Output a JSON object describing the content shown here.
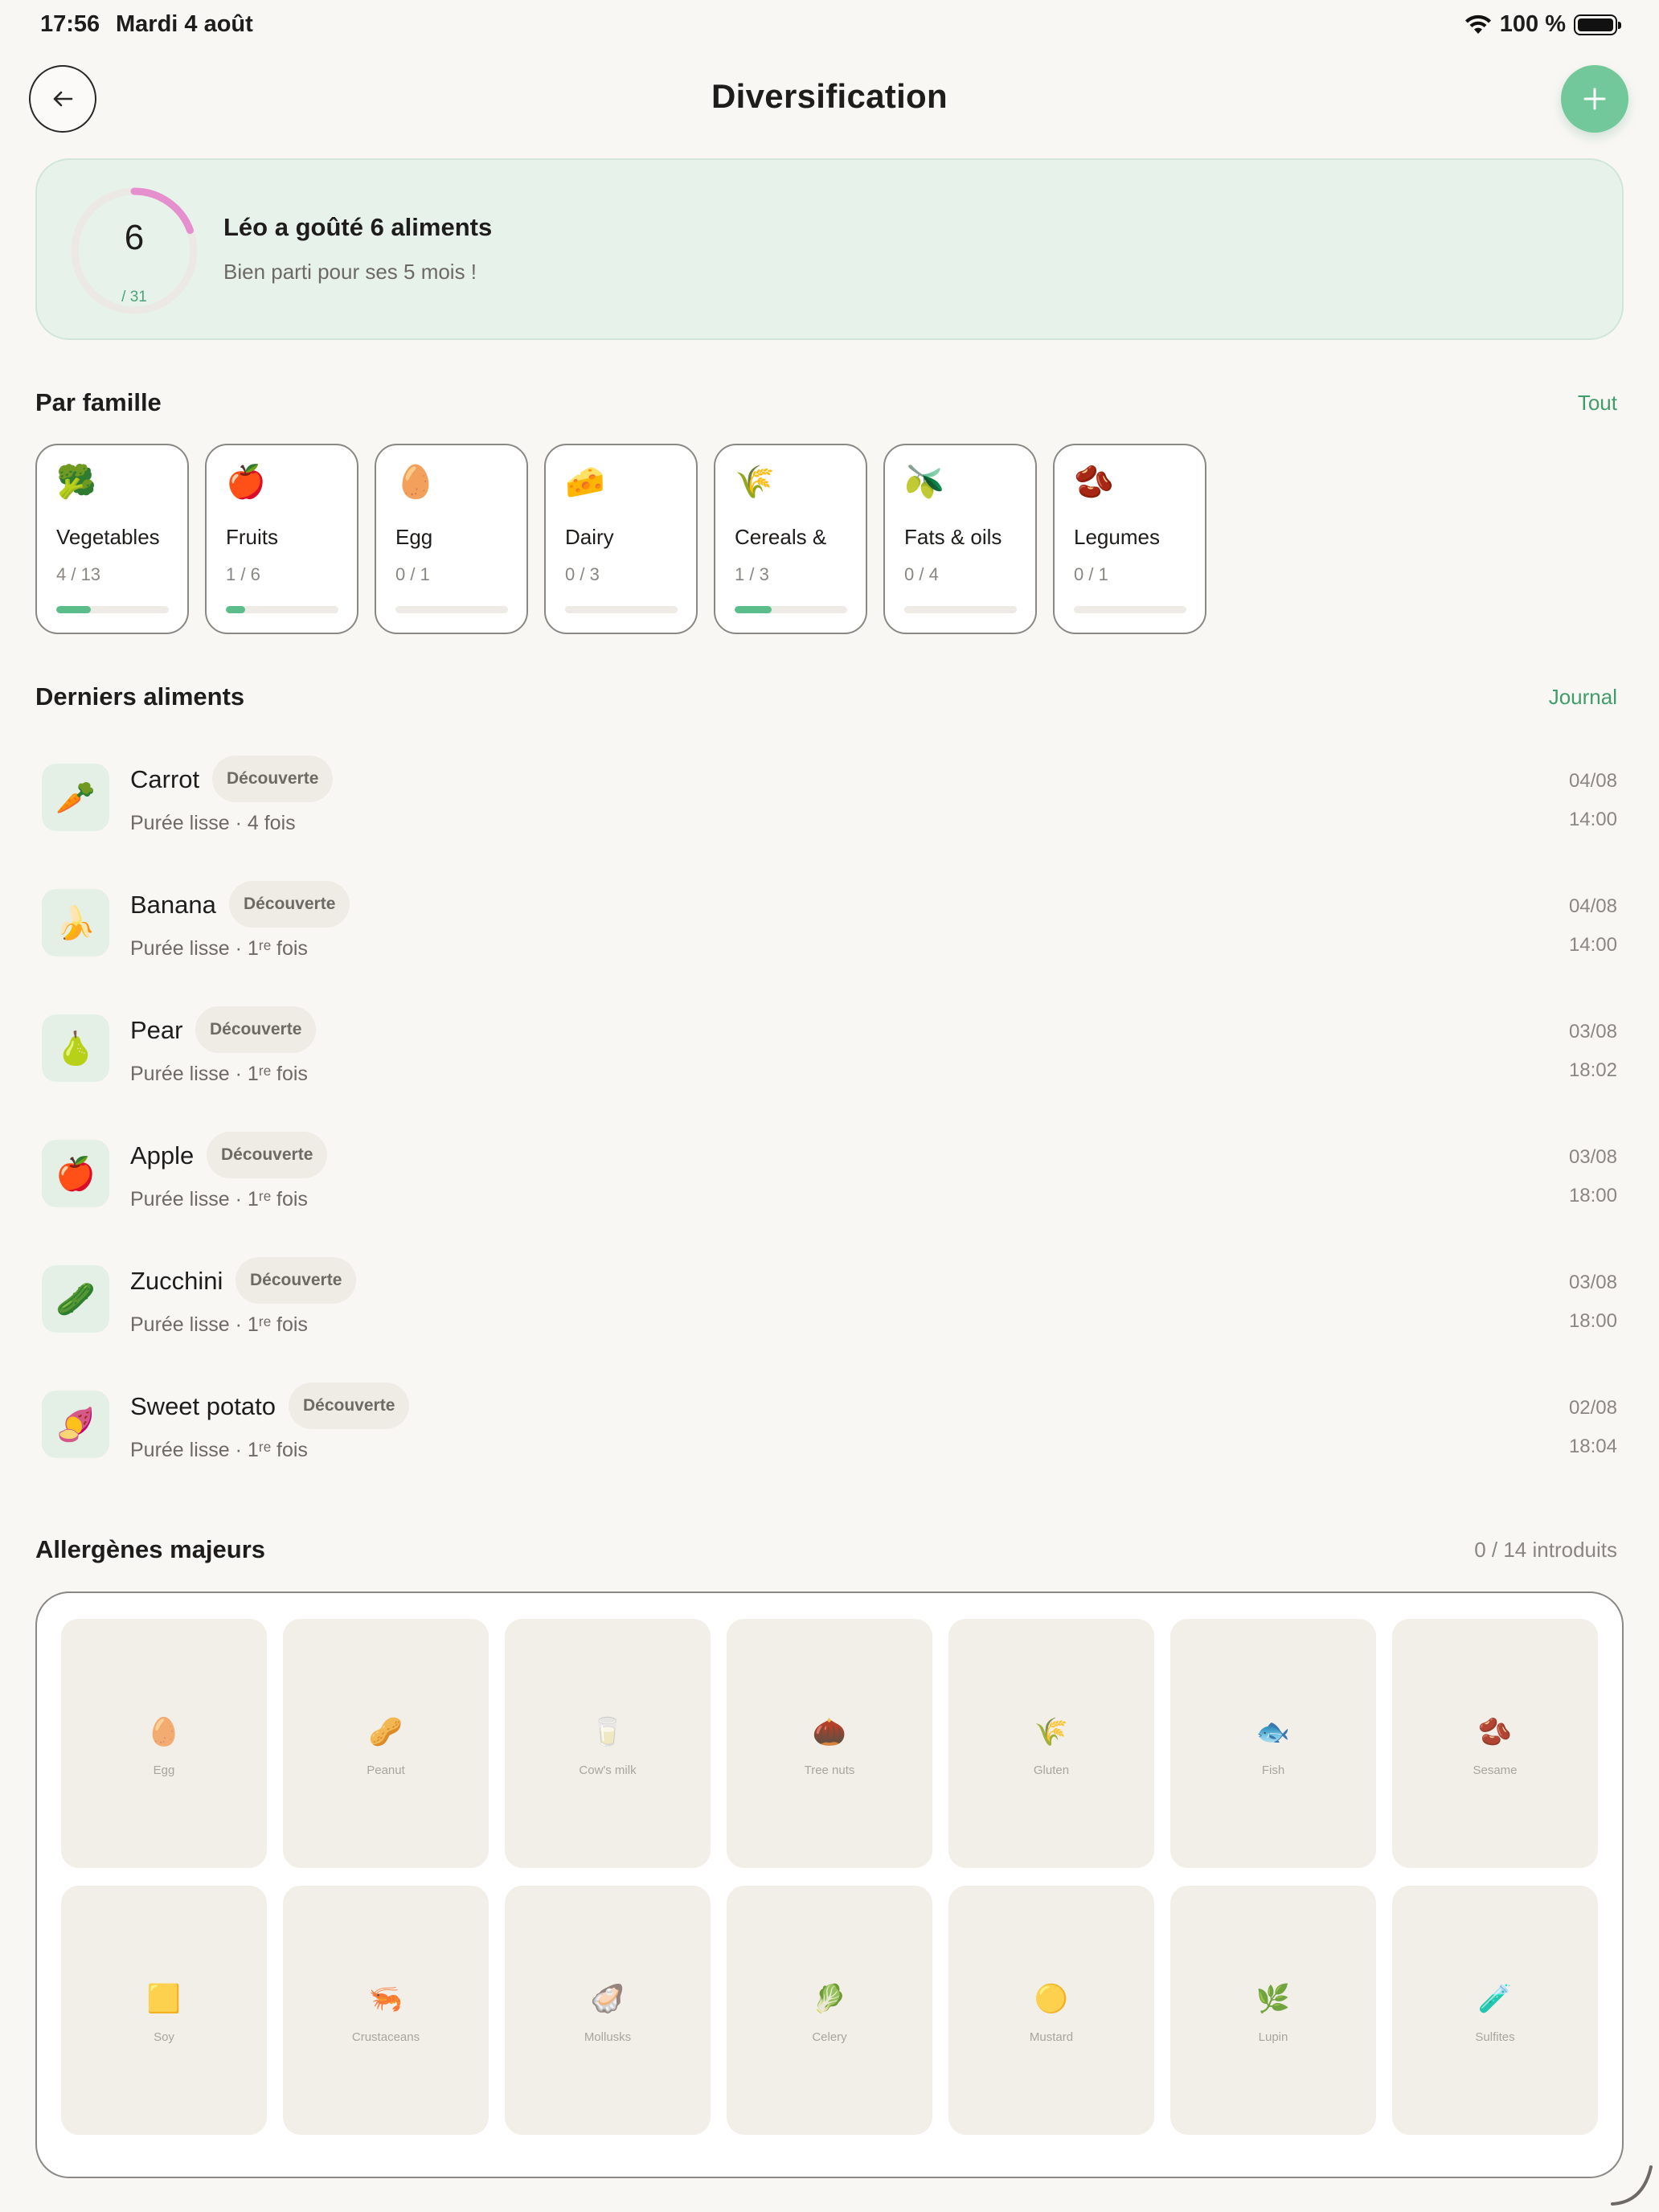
{
  "status_bar": {
    "time": "17:56",
    "date": "Mardi 4 août",
    "battery": "100 %"
  },
  "nav": {
    "title": "Diversification"
  },
  "summary": {
    "tasted": "6",
    "total": "/ 31",
    "headline": "Léo a goûté 6 aliments",
    "subtitle": "Bien parti pour ses 5 mois !",
    "progress_fraction": 0.194,
    "ring_color": "#e58fcf",
    "ring_track_color": "#ece8e3"
  },
  "families_section": {
    "title": "Par famille",
    "link": "Tout"
  },
  "families": [
    {
      "icon": "🥦",
      "icon_name": "broccoli-icon",
      "name": "Vegetables",
      "count": "4 / 13",
      "progress": 0.31
    },
    {
      "icon": "🍎",
      "icon_name": "apple-icon",
      "name": "Fruits",
      "count": "1 / 6",
      "progress": 0.17
    },
    {
      "icon": "🥚",
      "icon_name": "egg-icon",
      "name": "Egg",
      "count": "0 / 1",
      "progress": 0
    },
    {
      "icon": "🧀",
      "icon_name": "cheese-icon",
      "name": "Dairy",
      "count": "0 / 3",
      "progress": 0
    },
    {
      "icon": "🌾",
      "icon_name": "wheat-icon",
      "name": "Cereals &",
      "count": "1 / 3",
      "progress": 0.33
    },
    {
      "icon": "🫒",
      "icon_name": "olive-icon",
      "name": "Fats & oils",
      "count": "0 / 4",
      "progress": 0
    },
    {
      "icon": "🫘",
      "icon_name": "beans-icon",
      "name": "Legumes",
      "count": "0 / 1",
      "progress": 0
    }
  ],
  "recent_section": {
    "title": "Derniers aliments",
    "link": "Journal"
  },
  "recent": [
    {
      "icon": "🥕",
      "icon_name": "carrot-icon",
      "name": "Carrot",
      "badge": "Découverte",
      "texture": "Purée lisse · 4 fois",
      "date": "04/08",
      "time": "14:00"
    },
    {
      "icon": "🍌",
      "icon_name": "banana-icon",
      "name": "Banana",
      "badge": "Découverte",
      "texture": "Purée lisse · 1ʳᵉ fois",
      "date": "04/08",
      "time": "14:00"
    },
    {
      "icon": "🍐",
      "icon_name": "pear-icon",
      "name": "Pear",
      "badge": "Découverte",
      "texture": "Purée lisse · 1ʳᵉ fois",
      "date": "03/08",
      "time": "18:02"
    },
    {
      "icon": "🍎",
      "icon_name": "apple-icon",
      "name": "Apple",
      "badge": "Découverte",
      "texture": "Purée lisse · 1ʳᵉ fois",
      "date": "03/08",
      "time": "18:00"
    },
    {
      "icon": "🥒",
      "icon_name": "zucchini-icon",
      "name": "Zucchini",
      "badge": "Découverte",
      "texture": "Purée lisse · 1ʳᵉ fois",
      "date": "03/08",
      "time": "18:00"
    },
    {
      "icon": "🍠",
      "icon_name": "sweet-potato-icon",
      "name": "Sweet potato",
      "badge": "Découverte",
      "texture": "Purée lisse · 1ʳᵉ fois",
      "date": "02/08",
      "time": "18:04"
    }
  ],
  "allergens_section": {
    "title": "Allergènes majeurs",
    "meta": "0 / 14 introduits"
  },
  "allergens": [
    {
      "icon": "🥚",
      "icon_name": "egg-icon",
      "label": "Egg"
    },
    {
      "icon": "🥜",
      "icon_name": "peanut-icon",
      "label": "Peanut"
    },
    {
      "icon": "🥛",
      "icon_name": "milk-icon",
      "label": "Cow's milk"
    },
    {
      "icon": "🌰",
      "icon_name": "chestnut-icon",
      "label": "Tree nuts"
    },
    {
      "icon": "🌾",
      "icon_name": "wheat-icon",
      "label": "Gluten"
    },
    {
      "icon": "🐟",
      "icon_name": "fish-icon",
      "label": "Fish"
    },
    {
      "icon": "🫘",
      "icon_name": "beans-icon",
      "label": "Sesame"
    },
    {
      "icon": "🟨",
      "icon_name": "soy-square-icon",
      "label": "Soy"
    },
    {
      "icon": "🦐",
      "icon_name": "shrimp-icon",
      "label": "Crustaceans"
    },
    {
      "icon": "🦪",
      "icon_name": "oyster-icon",
      "label": "Mollusks"
    },
    {
      "icon": "🥬",
      "icon_name": "leafy-green-icon",
      "label": "Celery"
    },
    {
      "icon": "🟡",
      "icon_name": "mustard-circle-icon",
      "label": "Mustard"
    },
    {
      "icon": "🌿",
      "icon_name": "herb-icon",
      "label": "Lupin"
    },
    {
      "icon": "🧪",
      "icon_name": "test-tube-icon",
      "label": "Sulfites"
    }
  ],
  "colors": {
    "accent": "#3f9d6a",
    "add_button": "#73c89b",
    "summary_bg": "#e6f2ea",
    "page_bg": "#f9f7f4"
  }
}
